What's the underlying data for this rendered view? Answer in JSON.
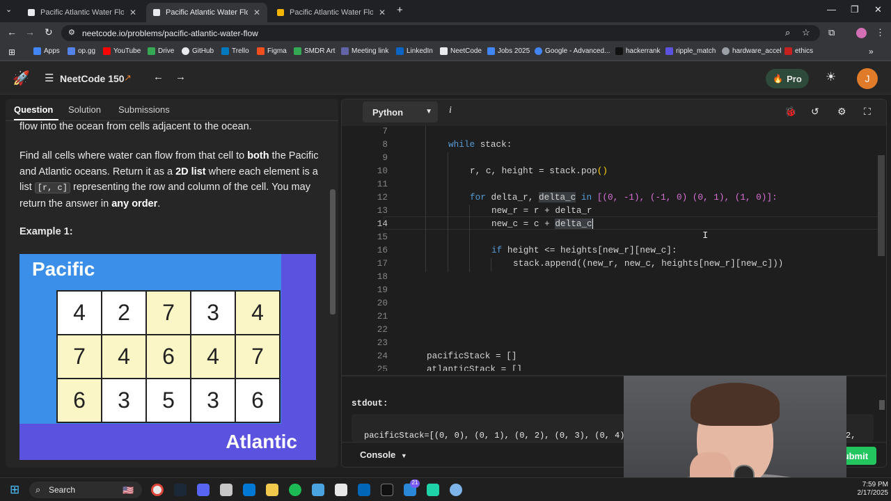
{
  "browser": {
    "tabs": [
      {
        "title": "Pacific Atlantic Water Flow - Ne"
      },
      {
        "title": "Pacific Atlantic Water Flow - Ne"
      },
      {
        "title": "Pacific Atlantic Water Flow - Le"
      }
    ],
    "url": "neetcode.io/problems/pacific-atlantic-water-flow",
    "bookmarks": [
      "Apps",
      "op.gg",
      "YouTube",
      "Drive",
      "GitHub",
      "Trello",
      "Figma",
      "SMDR Art",
      "Meeting link",
      "LinkedIn",
      "NeetCode",
      "Jobs 2025",
      "Google - Advanced...",
      "hackerrank",
      "ripple_match",
      "hardware_accel",
      "ethics"
    ]
  },
  "header": {
    "title": "NeetCode 150",
    "pro_label": "Pro",
    "avatar_initial": "J",
    "colors": {
      "pro_bg": "#2e4a3a",
      "avatar": "#e07b2a"
    }
  },
  "left": {
    "tabs": [
      "Question",
      "Solution",
      "Submissions"
    ],
    "para0": "flow into the ocean from cells adjacent to the ocean.",
    "para1_a": "Find all cells where water can flow from that cell to ",
    "para1_b": "both",
    "para1_c": " the Pacific and Atlantic oceans. Return it as a ",
    "para1_d": "2D list",
    "para1_e": " where each element is a list ",
    "para1_code": "[r, c]",
    "para1_f": " representing the row and column of the cell. You may return the answer in ",
    "para1_g": "any order",
    "para1_h": ".",
    "example_title": "Example 1:",
    "image": {
      "pacific": "Pacific",
      "atlantic": "Atlantic",
      "grid": [
        [
          "4",
          "2",
          "7",
          "3",
          "4"
        ],
        [
          "7",
          "4",
          "6",
          "4",
          "7"
        ],
        [
          "6",
          "3",
          "5",
          "3",
          "6"
        ]
      ]
    }
  },
  "editor": {
    "language": "Python",
    "info": "i",
    "line_numbers": [
      "7",
      "8",
      "9",
      "10",
      "11",
      "12",
      "13",
      "14",
      "15",
      "16",
      "17",
      "18",
      "19",
      "20",
      "21",
      "22",
      "23",
      "24",
      "25"
    ],
    "lines": {
      "l8_kw": "while",
      "l8_rest": " stack:",
      "l10": "r, c, height = stack.pop",
      "l10_paren": "()",
      "l12_kw": "for",
      "l12_a": " delta_r, ",
      "l12_hl": "delta_c",
      "l12_in": " in ",
      "l12_rest": "[(0, -1), (-1, 0) (0, 1), (1, 0)]:",
      "l13": "new_r = r + delta_r",
      "l14_a": "new_c = c + ",
      "l14_hl": "delta_c",
      "l16_kw": "if",
      "l16_rest": " height <= heights[new_r][new_c]:",
      "l17": "stack.append((new_r, new_c, heights[new_r][new_c]))",
      "l24": "pacificStack = []",
      "l25": "atlanticStack = []"
    },
    "stdout_label": "stdout:",
    "stdout_text": "pacificStack=[(0, 0), (0, 1), (0, 2), (0, 3), (0, 4), (",
    "stdout_tail": "2,",
    "console_label": "Console",
    "submit_label": "Submit"
  },
  "taskbar": {
    "search_label": "Search",
    "time": "7:59 PM",
    "date": "2/17/2025",
    "badge": "21"
  }
}
